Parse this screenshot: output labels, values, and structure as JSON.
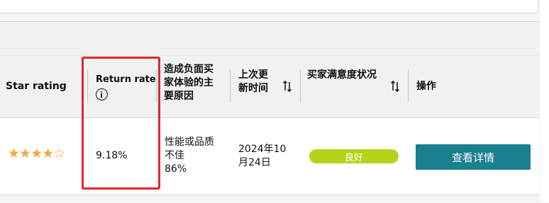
{
  "table": {
    "headers": {
      "star_rating": "Star rating",
      "return_rate": "Return rate",
      "negative_reason": "造成负面买家体验的主要原因",
      "last_updated": "上次更新时间",
      "satisfaction": "买家满意度状况",
      "actions": "操作"
    },
    "row": {
      "rating_value": 4.5,
      "return_rate": "9.18%",
      "negative_reason_line1": "性能或品质",
      "negative_reason_line2": "不佳",
      "negative_reason_pct": "86%",
      "last_updated_line1": "2024年10",
      "last_updated_line2": "月24日",
      "satisfaction_badge": "良好",
      "action_button": "查看详情"
    }
  },
  "colors": {
    "badge_green": "#b6d31a",
    "button_teal": "#1a7f8f",
    "star_orange": "#f3a847",
    "highlight_red": "#e3242b"
  },
  "icons": {
    "info": "info-circle-icon",
    "sort": "sort-arrows-icon",
    "star": "star-icon"
  }
}
